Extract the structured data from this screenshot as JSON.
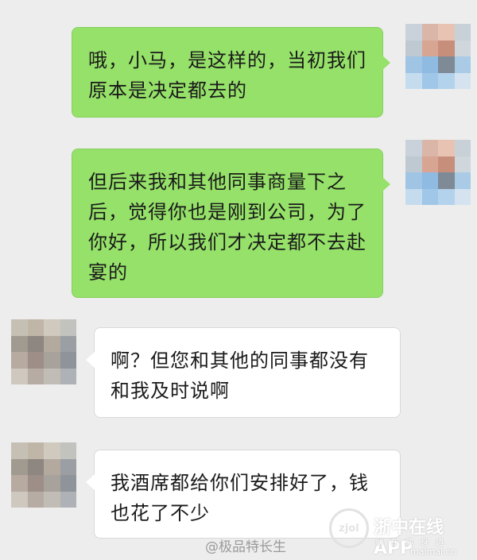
{
  "messages": [
    {
      "side": "right",
      "text": "哦，小马，是这样的，当初我们原本是决定都去的"
    },
    {
      "side": "right",
      "text": "但后来我和其他同事商量下之后，觉得你也是刚到公司，为了你好，所以我们才决定都不去赴宴的"
    },
    {
      "side": "left",
      "text": "啊？但您和其他的同事都没有和我及时说啊"
    },
    {
      "side": "left",
      "text": "我酒席都给你们安排好了，钱也花了不少"
    }
  ],
  "colors": {
    "background": "#ededed",
    "sent_bubble": "#95e169",
    "received_bubble": "#ffffff"
  },
  "avatars": {
    "self_icon": "pixelated-avatar-icon",
    "contact_icon": "pixelated-avatar-icon"
  },
  "watermarks": {
    "weibo": "@极品特长生",
    "app_name": "浙中在线APP",
    "app_slogan": "就在你身边",
    "domain": "maimai.cn"
  }
}
